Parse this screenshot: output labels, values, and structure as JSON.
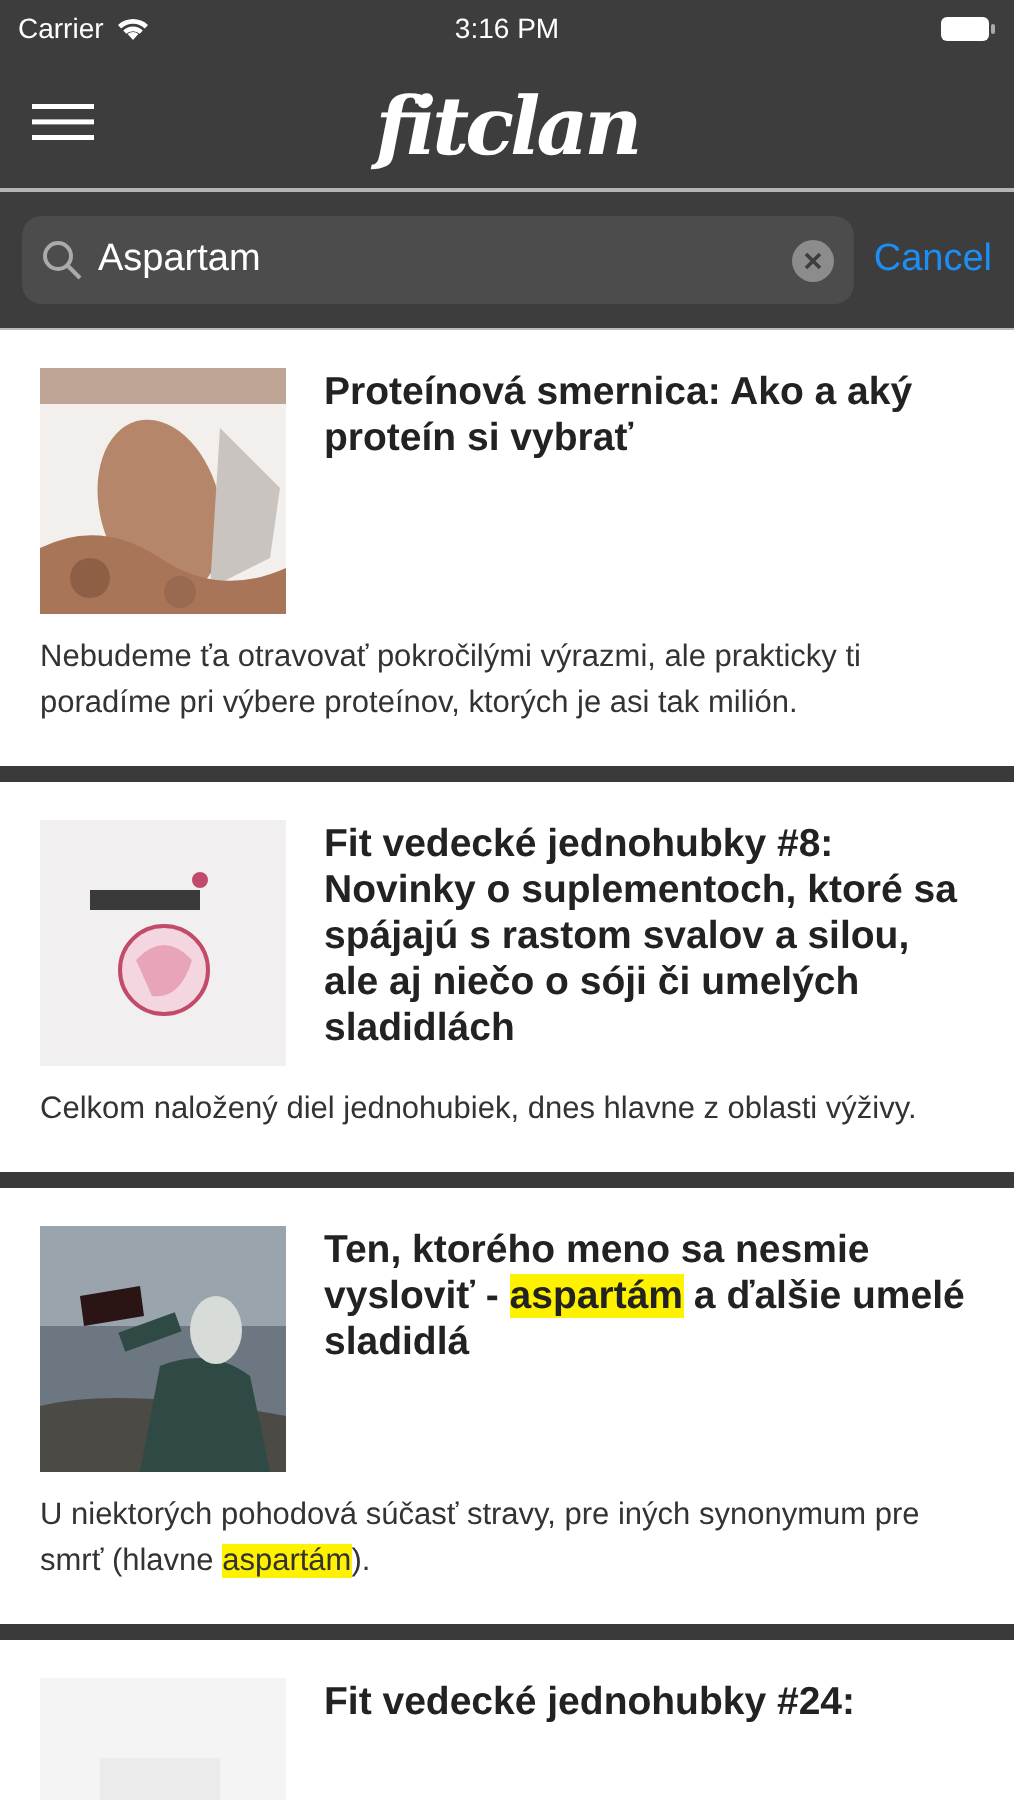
{
  "status_bar": {
    "carrier": "Carrier",
    "time": "3:16 PM"
  },
  "nav": {
    "logo": "fitclan"
  },
  "search": {
    "value": "Aspartam",
    "cancel": "Cancel"
  },
  "articles": [
    {
      "title": [
        {
          "text": "Proteínová smernica: Ako a aký proteín si vybrať",
          "highlighted": false
        }
      ],
      "summary": [
        {
          "text": "Nebudeme ťa otravovať pokročilými výrazmi, ale prakticky ti poradíme pri výbere proteínov, ktorých je asi tak milión.",
          "highlighted": false
        }
      ]
    },
    {
      "title": [
        {
          "text": "Fit vedecké jednohubky #8: Novinky o suplementoch, ktoré sa spájajú s rastom svalov a silou, ale aj niečo o sóji či umelých sladidlách",
          "highlighted": false
        }
      ],
      "summary": [
        {
          "text": "Celkom naložený diel jednohubiek, dnes hlavne z oblasti výživy.",
          "highlighted": false
        }
      ]
    },
    {
      "title": [
        {
          "text": "Ten, ktorého meno sa nesmie vysloviť - ",
          "highlighted": false
        },
        {
          "text": "aspartám",
          "highlighted": true
        },
        {
          "text": " a ďalšie umelé sladidlá",
          "highlighted": false
        }
      ],
      "summary": [
        {
          "text": "U niektorých pohodová súčasť stravy, pre iných synonymum pre smrť (hlavne ",
          "highlighted": false
        },
        {
          "text": "aspartám",
          "highlighted": true
        },
        {
          "text": ").",
          "highlighted": false
        }
      ]
    },
    {
      "title": [
        {
          "text": "Fit vedecké jednohubky #24:",
          "highlighted": false
        }
      ]
    }
  ]
}
